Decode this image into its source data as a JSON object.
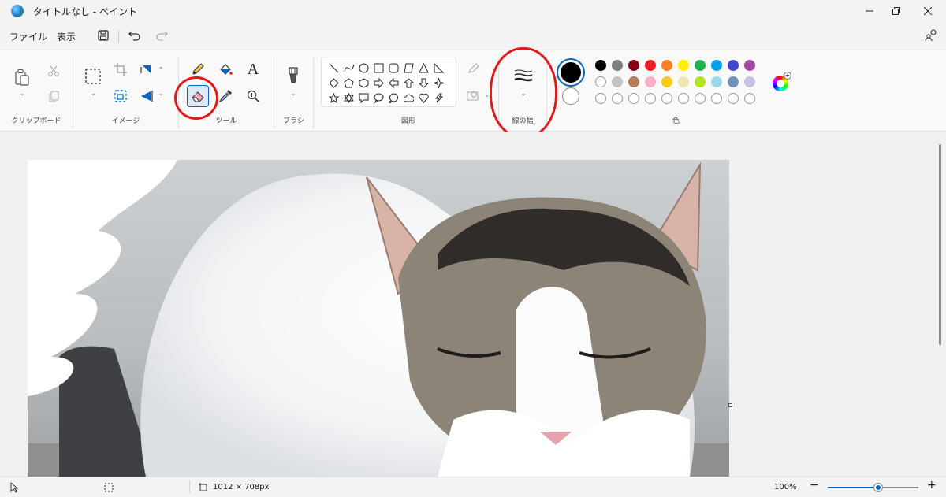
{
  "titlebar": {
    "title": "タイトルなし - ペイント"
  },
  "menu": {
    "file": "ファイル",
    "view": "表示"
  },
  "groups": {
    "clipboard": "クリップボード",
    "image": "イメージ",
    "tools": "ツール",
    "brushes": "ブラシ",
    "shapes": "図形",
    "size": "線の幅",
    "colors": "色"
  },
  "text_tool_glyph": "A",
  "palette": {
    "row1": [
      "#000000",
      "#7f7f7f",
      "#880015",
      "#ed1c24",
      "#ff7f27",
      "#fff200",
      "#22b14c",
      "#00a2e8",
      "#3f48cc",
      "#a349a4"
    ],
    "row2": [
      "#ffffff",
      "#c3c3c3",
      "#b97a57",
      "#ffaec9",
      "#ffc90e",
      "#efe4b0",
      "#b5e61d",
      "#99d9ea",
      "#7092be",
      "#c8bfe7"
    ],
    "primary": "#000000",
    "secondary": "#ffffff"
  },
  "status": {
    "canvas_size": "1012 × 708px",
    "zoom": "100%"
  },
  "zoom_level": 0.56
}
